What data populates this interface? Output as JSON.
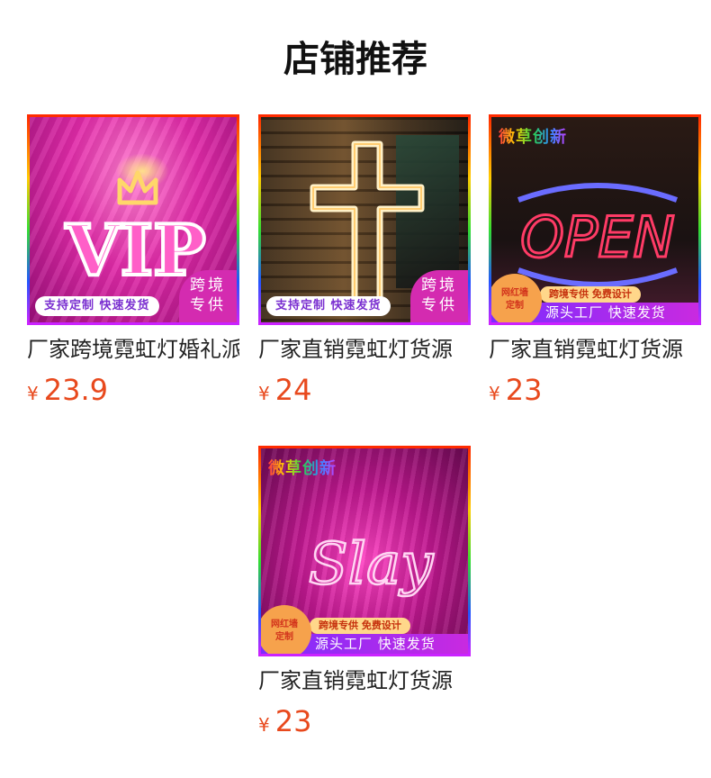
{
  "header": {
    "title": "店铺推荐"
  },
  "products": [
    {
      "name": "厂家跨境霓虹灯婚礼派对",
      "currency": "¥",
      "price": "23.9",
      "image": {
        "neon_text": "VIP",
        "badge_bar": "支持定制 快速发货",
        "badge_corner_line1": "跨境",
        "badge_corner_line2": "专供"
      }
    },
    {
      "name": "厂家直销霓虹灯货源",
      "currency": "¥",
      "price": "24",
      "image": {
        "badge_bar": "支持定制 快速发货",
        "badge_corner_line1": "跨境",
        "badge_corner_line2": "专供"
      }
    },
    {
      "name": "厂家直销霓虹灯货源",
      "currency": "¥",
      "price": "23",
      "image": {
        "neon_text": "OPEN",
        "brand": "微草创新",
        "circle_line1": "网红墙",
        "circle_line2": "定制",
        "pill": "跨境专供 免费设计",
        "bar": "源头工厂 快速发货"
      }
    },
    {
      "name": "厂家直销霓虹灯货源",
      "currency": "¥",
      "price": "23",
      "image": {
        "neon_text": "Slay",
        "brand": "微草创新",
        "circle_line1": "网红墙",
        "circle_line2": "定制",
        "pill": "跨境专供 免费设计",
        "bar": "源头工厂 快速发货"
      }
    }
  ],
  "colors": {
    "price": "#e8491d",
    "title": "#111111"
  }
}
